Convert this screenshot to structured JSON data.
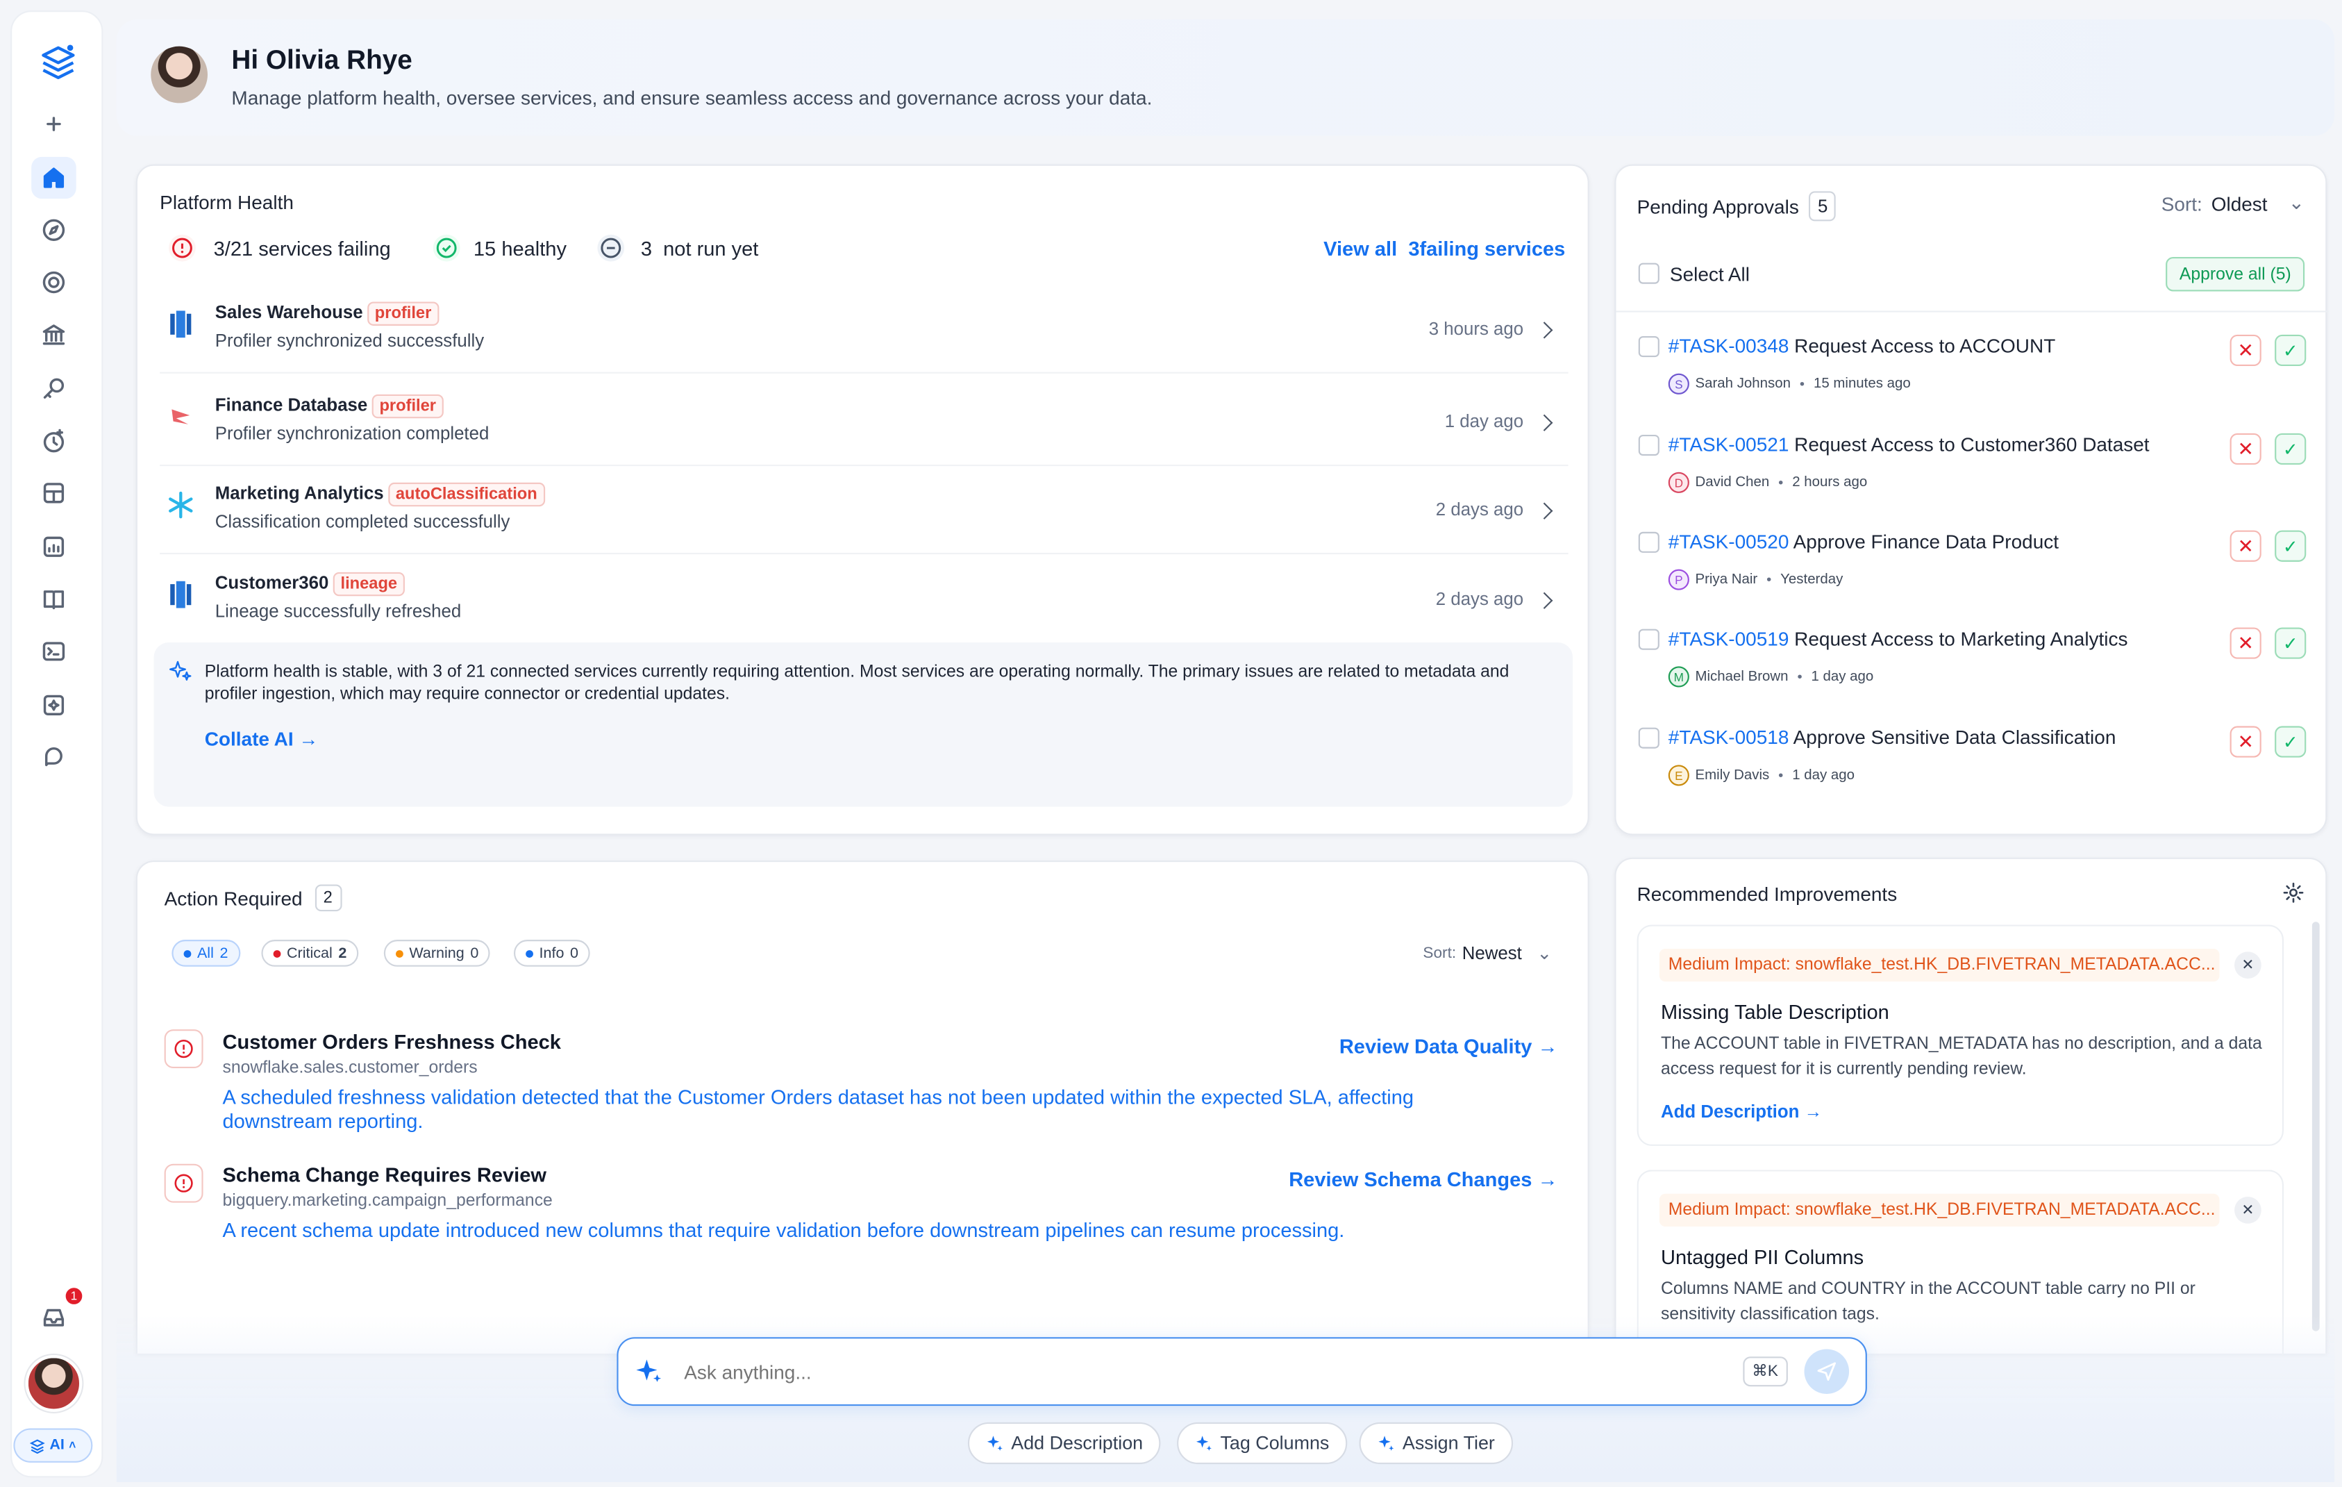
{
  "sidebar": {
    "items": [
      "add-icon",
      "home-icon",
      "compass-icon",
      "target-icon",
      "bank-icon",
      "key-search-icon",
      "clock-add-icon",
      "grid-box-icon",
      "chart-add-icon",
      "book-icon",
      "terminal-icon",
      "sparkle-box-icon",
      "chat-icon"
    ],
    "inbox_badge": "1",
    "ai_label": "AI"
  },
  "header": {
    "greeting": "Hi Olivia Rhye",
    "subtitle": "Manage platform health, oversee services, and ensure seamless access and governance across your data."
  },
  "platform_health": {
    "title": "Platform Health",
    "failing": "3/21 services failing",
    "healthy_count": "15",
    "healthy_label": "healthy",
    "notrun_count": "3",
    "notrun_label": "not run yet",
    "view_all": "View all",
    "view_all_count": "3",
    "view_all_suffix": "failing services",
    "rows": [
      {
        "name": "Sales Warehouse",
        "tag": "profiler",
        "desc": "Profiler synchronized successfully",
        "time": "3 hours ago"
      },
      {
        "name": "Finance Database",
        "tag": "profiler",
        "desc": "Profiler synchronization completed",
        "time": "1 day ago"
      },
      {
        "name": "Marketing Analytics",
        "tag": "autoClassification",
        "desc": "Classification completed successfully",
        "time": "2 days ago"
      },
      {
        "name": "Customer360",
        "tag": "lineage",
        "desc": "Lineage successfully refreshed",
        "time": "2 days ago"
      }
    ],
    "ai_summary": "Platform health is stable, with 3 of 21 connected services currently requiring attention. Most services are operating normally. The primary issues are related to metadata and profiler ingestion, which may require connector or credential updates.",
    "ai_link": "Collate AI"
  },
  "approvals": {
    "title": "Pending Approvals",
    "count": "5",
    "sort_label": "Sort:",
    "sort_value": "Oldest",
    "select_all": "Select All",
    "approve_all": "Approve all (5)",
    "tasks": [
      {
        "id": "#TASK-00348",
        "title": "Request Access to ACCOUNT",
        "initial": "S",
        "user": "Sarah Johnson",
        "time": "15 minutes ago",
        "color": "#6e56cf",
        "bg": "#efeafe"
      },
      {
        "id": "#TASK-00521",
        "title": "Request Access to Customer360 Dataset",
        "initial": "D",
        "user": "David Chen",
        "time": "2 hours ago",
        "color": "#d9455f",
        "bg": "#fde8ec"
      },
      {
        "id": "#TASK-00520",
        "title": "Approve Finance Data Product",
        "initial": "P",
        "user": "Priya Nair",
        "time": "Yesterday",
        "color": "#9b4de0",
        "bg": "#f4e9fd"
      },
      {
        "id": "#TASK-00519",
        "title": "Request Access to Marketing Analytics",
        "initial": "M",
        "user": "Michael Brown",
        "time": "1 day ago",
        "color": "#1f9d55",
        "bg": "#e5f6ec"
      },
      {
        "id": "#TASK-00518",
        "title": "Approve Sensitive Data Classification",
        "initial": "E",
        "user": "Emily Davis",
        "time": "1 day ago",
        "color": "#c98a0b",
        "bg": "#fdf3dc"
      }
    ]
  },
  "action_required": {
    "title": "Action Required",
    "count": "2",
    "filters": [
      {
        "label": "All",
        "count": "2",
        "color": "#1570ef"
      },
      {
        "label": "Critical",
        "count": "2",
        "color": "#e11d2a"
      },
      {
        "label": "Warning",
        "count": "0",
        "color": "#f79009"
      },
      {
        "label": "Info",
        "count": "0",
        "color": "#1570ef"
      }
    ],
    "sort_label": "Sort:",
    "sort_value": "Newest",
    "items": [
      {
        "title": "Customer Orders Freshness Check",
        "path": "snowflake.sales.customer_orders",
        "desc": "A scheduled freshness validation detected that the Customer Orders dataset has not been updated within the expected SLA, affecting downstream reporting.",
        "action": "Review Data Quality"
      },
      {
        "title": "Schema Change Requires Review",
        "path": "bigquery.marketing.campaign_performance",
        "desc": "A recent schema update introduced new columns that require validation before downstream pipelines can resume processing.",
        "action": "Review Schema Changes"
      }
    ]
  },
  "recommended": {
    "title": "Recommended Improvements",
    "items": [
      {
        "impact": "Medium Impact: snowflake_test.HK_DB.FIVETRAN_METADATA.ACC...",
        "title": "Missing Table Description",
        "desc": "The ACCOUNT table in FIVETRAN_METADATA has no description, and a data access request for it is currently pending review.",
        "link": "Add Description"
      },
      {
        "impact": "Medium Impact: snowflake_test.HK_DB.FIVETRAN_METADATA.ACC...",
        "title": "Untagged PII Columns",
        "desc": "Columns NAME and COUNTRY in the ACCOUNT table carry no PII or sensitivity classification tags.",
        "link": ""
      }
    ]
  },
  "ask": {
    "placeholder": "Ask anything...",
    "shortcut": "⌘K",
    "suggestions": [
      "Add Description",
      "Tag Columns",
      "Assign Tier"
    ]
  },
  "colors": {
    "accent": "#1570ef",
    "danger": "#e11d2a",
    "success": "#12b76a"
  }
}
